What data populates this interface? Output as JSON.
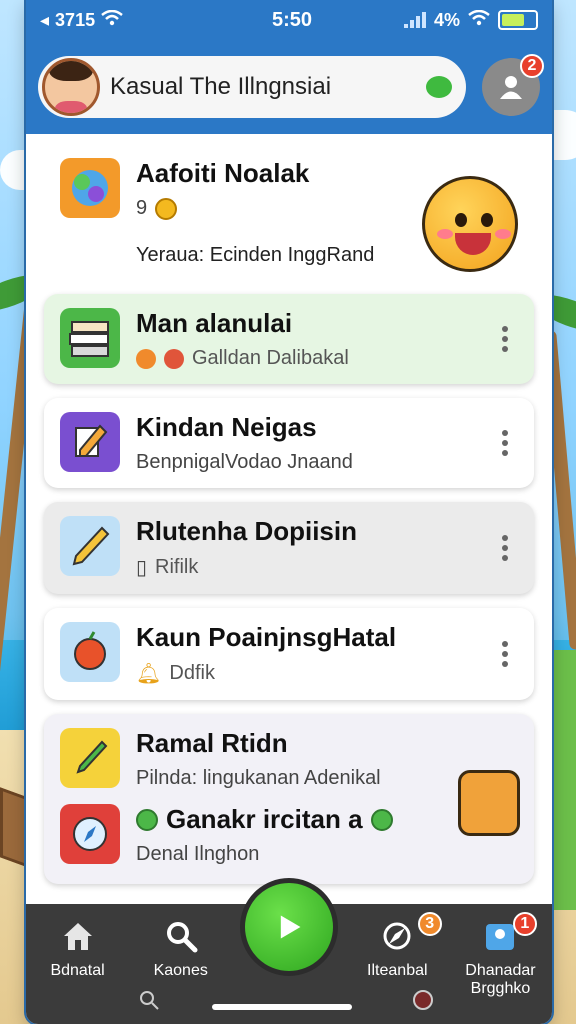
{
  "status": {
    "left_text": "3715",
    "time": "5:50",
    "battery_percent": "4%"
  },
  "header": {
    "search_text": "Kasual The Illngnsiai",
    "profile_badge": "2"
  },
  "hero": {
    "title": "Aafoiti Noalak",
    "meta": "9",
    "subtitle": "Yeraua: Ecinden InggRand"
  },
  "items": [
    {
      "title": "Man alanulai",
      "subtitle": "Galldan Dalibakal"
    },
    {
      "title": "Kindan Neigas",
      "subtitle": "BenpnigalVodao Jnaand"
    },
    {
      "title": "Rlutenha Dopiisin",
      "subtitle": "Rifilk"
    },
    {
      "title": "Kaun PoainjnsgHatal",
      "subtitle": "Ddfik"
    }
  ],
  "group": {
    "title": "Ramal Rtidn",
    "subtitle": "Pilnda: lingukanan Adenikal",
    "title2": "Ganakr ircitan a",
    "subtitle2": "Denal Ilnghon"
  },
  "nav": {
    "home": "Bdnatal",
    "search": "Kaones",
    "alerts": "Ilteanbal",
    "alerts_badge": "3",
    "profile": "Dhanadar\nBrgghko",
    "profile_badge": "1"
  },
  "colors": {
    "header_blue": "#2b78c6",
    "play_green": "#3fba3f",
    "badge_red": "#e8402c",
    "nav_bg": "#3b3b3b"
  }
}
